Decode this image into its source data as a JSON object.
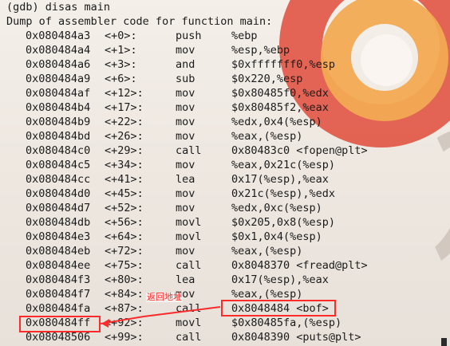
{
  "terminal": {
    "prompt_line": "(gdb) disas main",
    "header": "Dump of assembler code for function main:"
  },
  "instructions": [
    {
      "address": "0x080484a3",
      "offset": "<+0>:",
      "mnemonic": "push",
      "operands": "%ebp"
    },
    {
      "address": "0x080484a4",
      "offset": "<+1>:",
      "mnemonic": "mov",
      "operands": "%esp,%ebp"
    },
    {
      "address": "0x080484a6",
      "offset": "<+3>:",
      "mnemonic": "and",
      "operands": "$0xfffffff0,%esp"
    },
    {
      "address": "0x080484a9",
      "offset": "<+6>:",
      "mnemonic": "sub",
      "operands": "$0x220,%esp"
    },
    {
      "address": "0x080484af",
      "offset": "<+12>:",
      "mnemonic": "mov",
      "operands": "$0x80485f0,%edx"
    },
    {
      "address": "0x080484b4",
      "offset": "<+17>:",
      "mnemonic": "mov",
      "operands": "$0x80485f2,%eax"
    },
    {
      "address": "0x080484b9",
      "offset": "<+22>:",
      "mnemonic": "mov",
      "operands": "%edx,0x4(%esp)"
    },
    {
      "address": "0x080484bd",
      "offset": "<+26>:",
      "mnemonic": "mov",
      "operands": "%eax,(%esp)"
    },
    {
      "address": "0x080484c0",
      "offset": "<+29>:",
      "mnemonic": "call",
      "operands": "0x80483c0 <fopen@plt>"
    },
    {
      "address": "0x080484c5",
      "offset": "<+34>:",
      "mnemonic": "mov",
      "operands": "%eax,0x21c(%esp)"
    },
    {
      "address": "0x080484cc",
      "offset": "<+41>:",
      "mnemonic": "lea",
      "operands": "0x17(%esp),%eax"
    },
    {
      "address": "0x080484d0",
      "offset": "<+45>:",
      "mnemonic": "mov",
      "operands": "0x21c(%esp),%edx"
    },
    {
      "address": "0x080484d7",
      "offset": "<+52>:",
      "mnemonic": "mov",
      "operands": "%edx,0xc(%esp)"
    },
    {
      "address": "0x080484db",
      "offset": "<+56>:",
      "mnemonic": "movl",
      "operands": "$0x205,0x8(%esp)"
    },
    {
      "address": "0x080484e3",
      "offset": "<+64>:",
      "mnemonic": "movl",
      "operands": "$0x1,0x4(%esp)"
    },
    {
      "address": "0x080484eb",
      "offset": "<+72>:",
      "mnemonic": "mov",
      "operands": "%eax,(%esp)"
    },
    {
      "address": "0x080484ee",
      "offset": "<+75>:",
      "mnemonic": "call",
      "operands": "0x8048370 <fread@plt>"
    },
    {
      "address": "0x080484f3",
      "offset": "<+80>:",
      "mnemonic": "lea",
      "operands": "0x17(%esp),%eax"
    },
    {
      "address": "0x080484f7",
      "offset": "<+84>:",
      "mnemonic": "mov",
      "operands": "%eax,(%esp)"
    },
    {
      "address": "0x080484fa",
      "offset": "<+87>:",
      "mnemonic": "call",
      "operands": "0x8048484 <bof>"
    },
    {
      "address": "0x080484ff",
      "offset": "<+92>:",
      "mnemonic": "movl",
      "operands": "$0x80485fa,(%esp)"
    },
    {
      "address": "0x08048506",
      "offset": "<+99>:",
      "mnemonic": "call",
      "operands": "0x8048390 <puts@plt>"
    }
  ],
  "annotation": {
    "label": "返回地址",
    "color": "#ff2b2b"
  }
}
